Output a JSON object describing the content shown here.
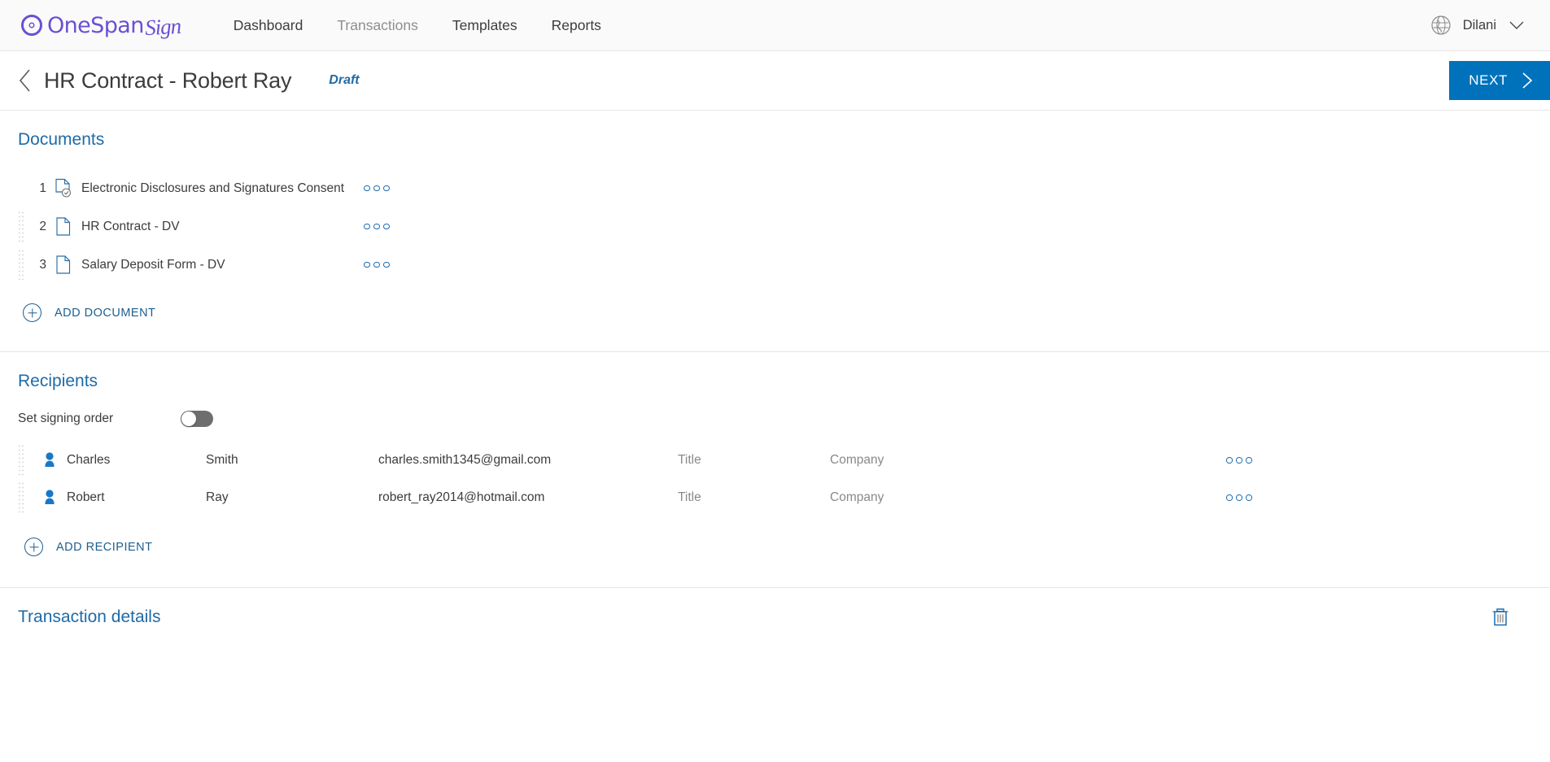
{
  "topnav": {
    "logo": {
      "primary": "OneSpan",
      "script": "Sign",
      "icon": "onespan-logo-icon"
    },
    "links": [
      {
        "label": "Dashboard",
        "active": true
      },
      {
        "label": "Transactions",
        "active": false
      },
      {
        "label": "Templates",
        "active": true
      },
      {
        "label": "Reports",
        "active": true
      }
    ],
    "globe_icon": "globe-icon",
    "user": "Dilani",
    "chevron_icon": "chevron-down-icon"
  },
  "titlebar": {
    "back_icon": "chevron-left-icon",
    "title": "HR Contract - Robert Ray",
    "status": "Draft",
    "next_label": "NEXT",
    "next_icon": "chevron-right-icon",
    "accent_color": "#0072bc"
  },
  "documents": {
    "heading": "Documents",
    "items": [
      {
        "num": "1",
        "name": "Electronic Disclosures and Signatures Consent",
        "icon": "document-check-icon",
        "draggable": false
      },
      {
        "num": "2",
        "name": "HR Contract - DV",
        "icon": "document-icon",
        "draggable": true
      },
      {
        "num": "3",
        "name": "Salary Deposit Form - DV",
        "icon": "document-icon",
        "draggable": true
      }
    ],
    "add_label": "ADD DOCUMENT",
    "menu_icon": "more-options-icon"
  },
  "recipients": {
    "heading": "Recipients",
    "signing_order_label": "Set signing order",
    "signing_order_on": false,
    "items": [
      {
        "first": "Charles",
        "last": "Smith",
        "email": "charles.smith1345@gmail.com",
        "title": "Title",
        "company": "Company",
        "icon": "person-icon"
      },
      {
        "first": "Robert",
        "last": "Ray",
        "email": "robert_ray2014@hotmail.com",
        "title": "Title",
        "company": "Company",
        "icon": "person-icon"
      }
    ],
    "add_label": "ADD RECIPIENT",
    "menu_icon": "more-options-icon"
  },
  "transaction_details": {
    "heading": "Transaction details",
    "delete_icon": "trash-icon"
  },
  "colors": {
    "brand_purple": "#6b4fd4",
    "link_blue": "#1e6ba8",
    "button_blue": "#0072bc",
    "person_blue": "#1878c8",
    "text_dark": "#3c3c3c",
    "placeholder_gray": "#898989"
  }
}
